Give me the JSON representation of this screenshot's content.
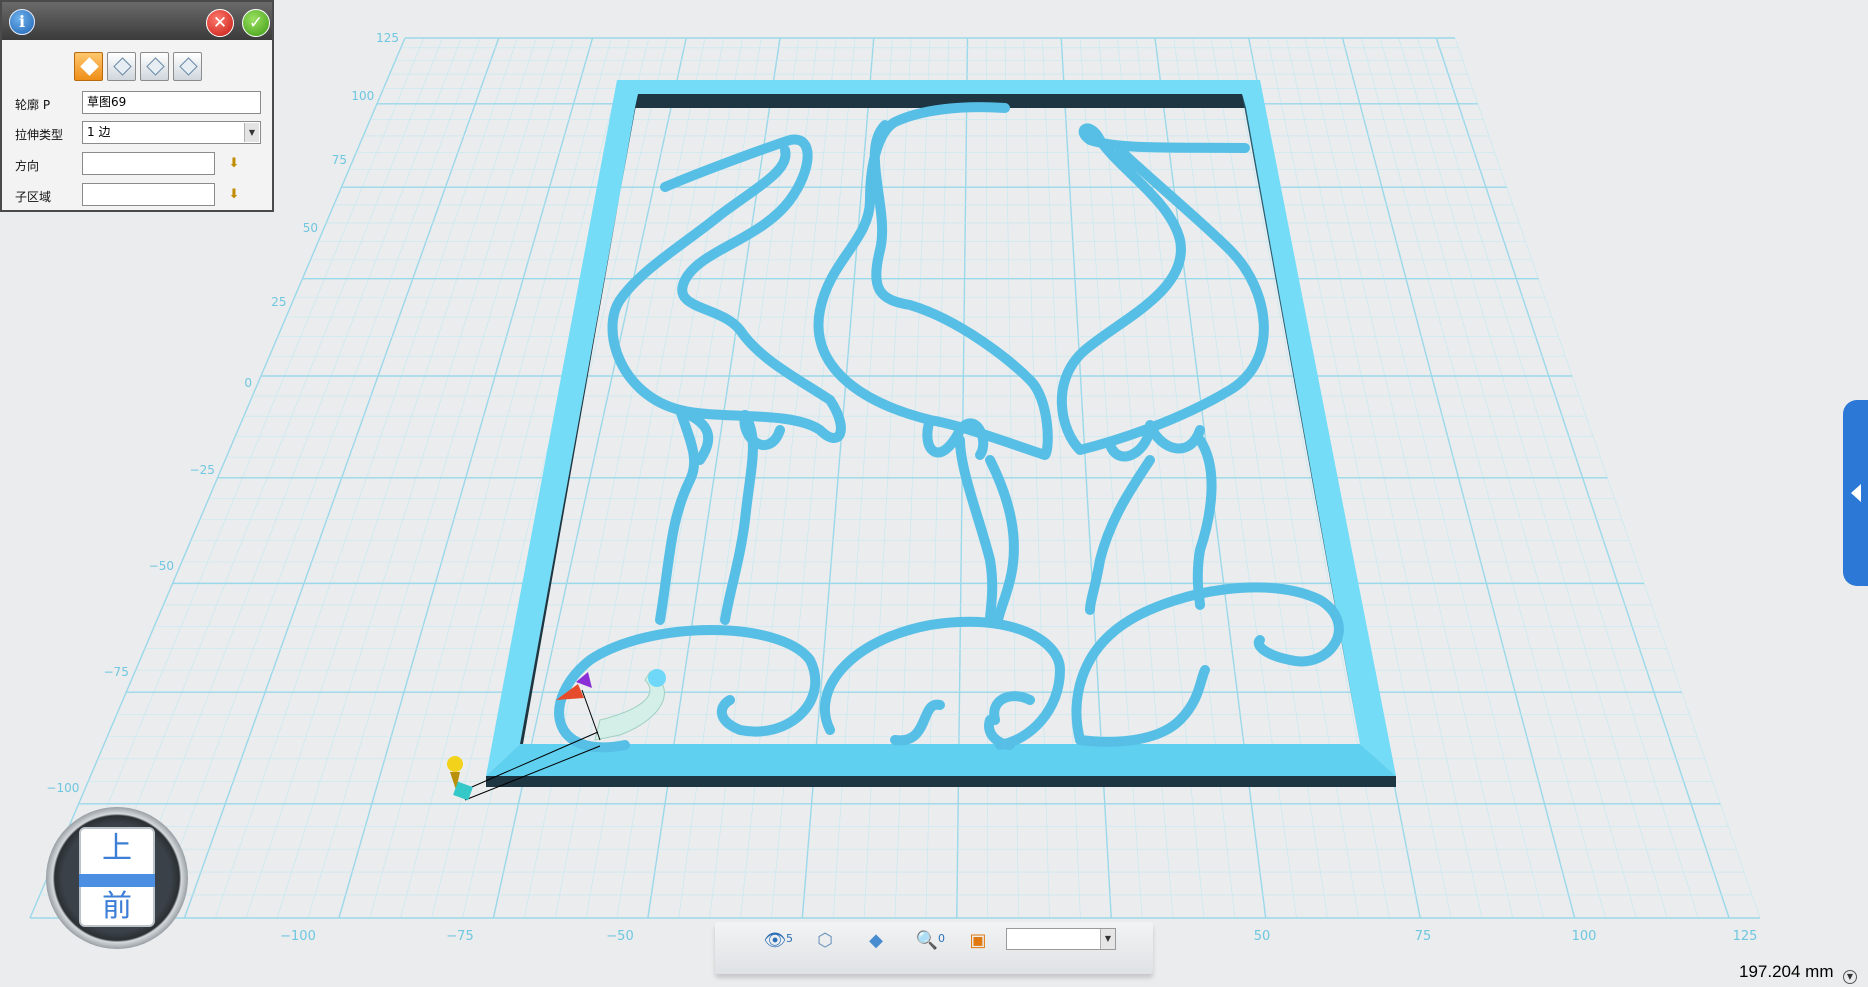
{
  "dialog": {
    "info_icon_glyph": "i",
    "close_glyph": "✕",
    "ok_glyph": "✓",
    "mode_icons": [
      "extrude-one-side-icon",
      "extrude-symmetric-icon",
      "extrude-cut-icon",
      "extrude-both-icon"
    ],
    "active_mode_index": 0,
    "fields": {
      "profile": {
        "label": "轮廓 P",
        "value": "草图69"
      },
      "extrude_type": {
        "label": "拉伸类型",
        "value": "1 边"
      },
      "direction": {
        "label": "方向",
        "value": ""
      },
      "sub_region": {
        "label": "子区域",
        "value": ""
      }
    }
  },
  "viewport": {
    "grid_color": "#a9dfee",
    "model_color": "#5cc3ea",
    "frame_color": "#70dcf8",
    "y_axis_labels": [
      "125",
      "100",
      "75",
      "50",
      "25",
      "0",
      "−25",
      "−50",
      "−75",
      "−100"
    ],
    "x_axis_labels": [
      "−100",
      "−75",
      "−50",
      "50",
      "75",
      "100",
      "125"
    ]
  },
  "view_cube": {
    "top_label": "上",
    "front_label": "前"
  },
  "toolbar": {
    "icons": [
      "view-visibility-icon",
      "view-cube-icon",
      "render-mode-icon",
      "zoom-icon",
      "fit-view-icon"
    ],
    "eye_suffix": "5",
    "zoom_suffix": "0",
    "select_value": ""
  },
  "status": {
    "measurement": "197.204 mm"
  },
  "colors": {
    "accent": "#2b78d6",
    "active_mode": "#f0a030"
  }
}
